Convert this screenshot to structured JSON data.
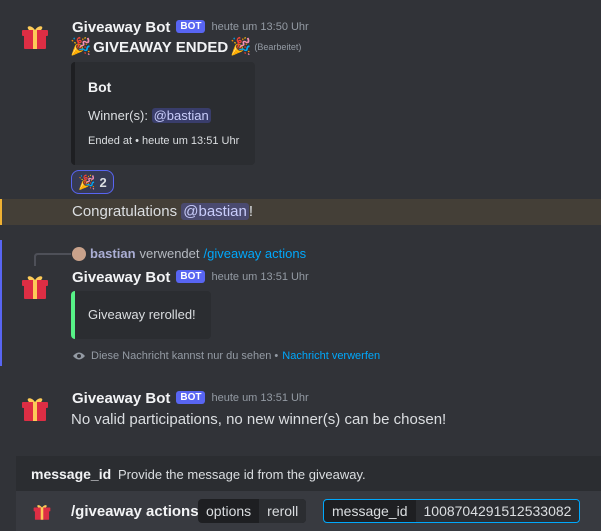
{
  "msg1": {
    "username": "Giveaway Bot",
    "bot_tag": "BOT",
    "timestamp": "heute um 13:50 Uhr",
    "title": "GIVEAWAY ENDED",
    "edited": "(Bearbeitet)",
    "embed": {
      "title": "Bot",
      "winners_label": "Winner(s):",
      "winner_mention": "@bastian",
      "ended_label": "Ended at • heute um 13:51 Uhr"
    },
    "reaction_count": "2"
  },
  "congrats": {
    "text_before": "Congratulations",
    "mention": "@bastian",
    "text_after": "!"
  },
  "msg2": {
    "reply_user": "bastian",
    "reply_text": "verwendet",
    "reply_command": "/giveaway actions",
    "username": "Giveaway Bot",
    "bot_tag": "BOT",
    "timestamp": "heute um 13:51 Uhr",
    "embed_text": "Giveaway rerolled!",
    "ephemeral_note": "Diese Nachricht kannst nur du sehen •",
    "dismiss_link": "Nachricht verwerfen"
  },
  "msg3": {
    "username": "Giveaway Bot",
    "bot_tag": "BOT",
    "timestamp": "heute um 13:51 Uhr",
    "text": "No valid participations, no new winner(s) can be chosen!"
  },
  "command_hint": {
    "option_name": "message_id",
    "option_desc": "Provide the message id from the giveaway."
  },
  "command_bar": {
    "command": "/giveaway actions",
    "option1": "options",
    "option1_value": "reroll",
    "option2": "message_id",
    "option2_value": "1008704291512533082"
  },
  "colors": {
    "accent": "#5865f2",
    "embed_green": "#57f287",
    "highlight": "#f0b132",
    "link": "#00a8fc"
  }
}
